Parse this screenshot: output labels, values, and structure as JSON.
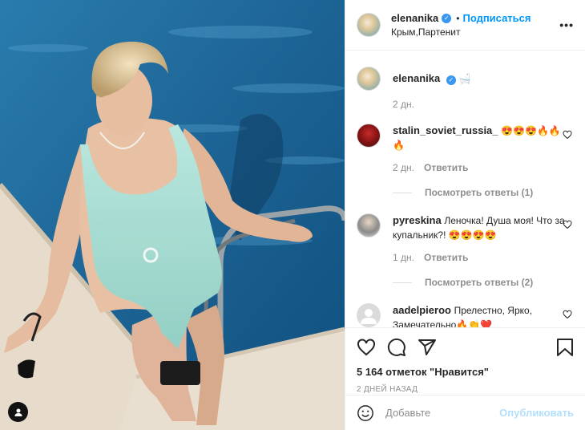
{
  "post": {
    "author": "elenanika",
    "follow_label": "Подписаться",
    "separator": "•",
    "location": "Крым,Партенит",
    "more_label": "•••"
  },
  "caption": {
    "username": "elenanika",
    "text": "🛁",
    "time": "2 дн."
  },
  "comments": [
    {
      "username": "stalin_soviet_russia_",
      "text": "😍😍😍🔥🔥🔥",
      "time": "2 дн.",
      "reply_label": "Ответить",
      "view_replies": "Посмотреть ответы (1)"
    },
    {
      "username": "pyreskina",
      "text": "Леночка! Душа моя! Что за купальник?! 😍😍😍😍",
      "time": "1 дн.",
      "reply_label": "Ответить",
      "view_replies": "Посмотреть ответы (2)"
    },
    {
      "username": "aadelpieroo",
      "text": "Прелестно, Ярко, Замечательно🔥👏❤️"
    }
  ],
  "stats": {
    "likes": "5 164 отметок \"Нравится\"",
    "date": "2 ДНЕЙ НАЗАД"
  },
  "composer": {
    "placeholder": "Добавьте",
    "publish_label": "Опубликовать"
  },
  "colors": {
    "accent": "#0095f6",
    "publish_disabled": "#b2dffc",
    "pool": "#1d6a9a",
    "swimsuit": "#a9ded3"
  }
}
